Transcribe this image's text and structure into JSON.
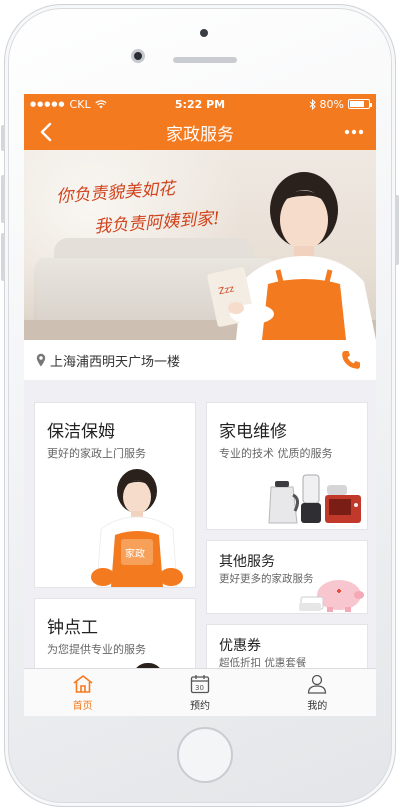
{
  "status_bar": {
    "carrier": "CKL",
    "time": "5:22 PM",
    "battery": "80%",
    "battery_level": 0.8,
    "icons": [
      "signal-dots-icon",
      "wifi-icon",
      "bluetooth-icon",
      "battery-icon"
    ]
  },
  "nav": {
    "title": "家政服务",
    "back_icon": "back-chevron-icon",
    "more_icon": "more-dots-icon"
  },
  "banner": {
    "slogan_line1": "你负责貌美如花",
    "slogan_line2": "我负责阿姨到家!",
    "logo_text": "Zzz"
  },
  "location": {
    "address": "上海浦西明天广场一楼",
    "pin_icon": "location-pin-icon",
    "call_icon": "phone-icon"
  },
  "services": [
    {
      "name": "保洁保姆",
      "desc": "更好的家政上门服务",
      "badge": "家政"
    },
    {
      "name": "家电维修",
      "desc": "专业的技术 优质的服务"
    },
    {
      "name": "其他服务",
      "desc": "更好更多的家政服务"
    },
    {
      "name": "钟点工",
      "desc": "为您提供专业的服务"
    },
    {
      "name": "优惠券",
      "desc": "超低折扣 优惠套餐"
    }
  ],
  "tabbar": {
    "items": [
      {
        "label": "首页",
        "icon": "home-icon",
        "active": true
      },
      {
        "label": "预约",
        "icon": "calendar-icon",
        "calendar_day": "30",
        "active": false
      },
      {
        "label": "我的",
        "icon": "user-icon",
        "active": false
      }
    ]
  },
  "colors": {
    "accent": "#f47a1f",
    "slogan": "#d0431c",
    "background": "#efeff4"
  }
}
